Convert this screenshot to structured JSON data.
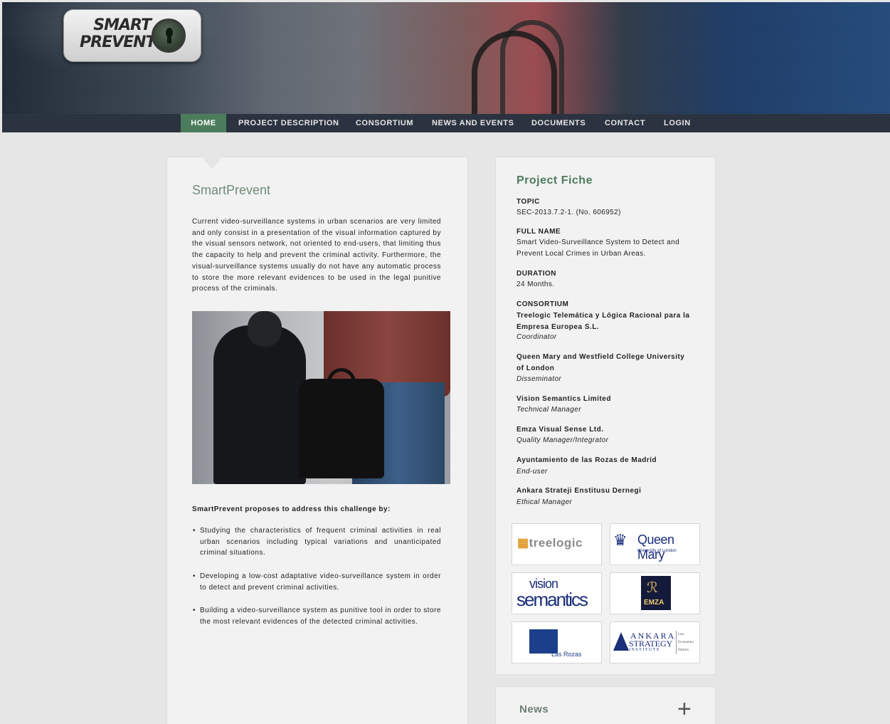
{
  "logo": {
    "line1": "SMART",
    "line2": "PREVENT"
  },
  "nav": {
    "items": [
      {
        "label": "HOME"
      },
      {
        "label": "PROJECT DESCRIPTION"
      },
      {
        "label": "CONSORTIUM"
      },
      {
        "label": "NEWS AND EVENTS"
      },
      {
        "label": "DOCUMENTS"
      },
      {
        "label": "CONTACT"
      },
      {
        "label": "LOGIN"
      }
    ]
  },
  "main": {
    "title": "SmartPrevent",
    "intro": "Current video-surveillance systems in urban scenarios are very limited and only consist in a presentation of the visual information captured by the visual sensors network, not oriented to end-users, that limiting thus the capacity to help and prevent the criminal activity. Furthermore, the visual-surveillance systems usually do not have any automatic process to store the more relevant evidences to be used in the legal punitive process of the criminals.",
    "subhead": "SmartPrevent proposes to address this challenge by:",
    "bullets": [
      "Studying the characteristics of frequent criminal activities in real urban scenarios including typical variations and unanticipated criminal situations.",
      "Developing a low-cost adaptative video-surveillance system in order to detect and prevent criminal activities.",
      "Building a video-surveillance system as punitive tool in order to store the most relevant evidences of the detected criminal activities."
    ]
  },
  "fiche": {
    "title": "Project Fiche",
    "topic_label": "TOPIC",
    "topic": "SEC-2013.7.2-1. (No. 606952)",
    "fullname_label": "FULL NAME",
    "fullname": "Smart Video-Surveillance System to Detect and Prevent Local Crimes in Urban Areas.",
    "duration_label": "DURATION",
    "duration": "24 Months.",
    "consortium_label": "CONSORTIUM",
    "members": [
      {
        "org": "Treelogic Telemática y Lógica Racional para la Empresa Europea S.L.",
        "role": "Coordinator"
      },
      {
        "org": "Queen Mary and Westfield College University of London",
        "role": "Disseminator"
      },
      {
        "org": "Vision Semantics Limited",
        "role": "Technical Manager"
      },
      {
        "org": "Emza Visual Sense Ltd.",
        "role": "Quality Manager/Integrator"
      },
      {
        "org": "Ayuntamiento de las Rozas de Madrid",
        "role": "End-user"
      },
      {
        "org": "Ankara Strateji Enstitusu Dernegi",
        "role": "Ethical Manager"
      }
    ],
    "logos": {
      "treelogic": "treelogic",
      "qm": "Queen Mary",
      "qm_sub": "University of London",
      "vs1": "vision",
      "vs2": "semantics",
      "emza": "EMZA",
      "rozas": "Las Rozas",
      "ankara1": "ANKARA",
      "ankara2": "STRATEGY",
      "ankara3": "INSTITUTE",
      "ankara_side": [
        "Law",
        "Economics",
        "Politics"
      ]
    }
  },
  "news": {
    "title": "News",
    "toggle": "+"
  },
  "colors": {
    "accent": "#4b7d5c",
    "nav_bg": "#2b3340",
    "title_green": "#4e7a5b"
  }
}
